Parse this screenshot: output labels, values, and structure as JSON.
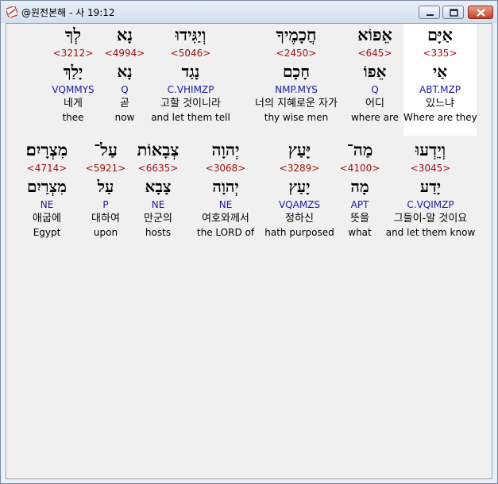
{
  "window": {
    "title": "@원전본해 - 사 19:12",
    "buttons": {
      "minimize": "minimize",
      "maximize": "maximize",
      "close": "close"
    }
  },
  "rows": [
    {
      "words": [
        {
          "hebrew": "אַיָּם",
          "strong": "<335>",
          "lemma": "אַי",
          "morph": "ABT.MZP",
          "korean": "있느냐",
          "english": "Where are they",
          "highlighted": true
        },
        {
          "hebrew": "אֵפוֹא",
          "strong": "<645>",
          "lemma": "אֵפוֹ",
          "morph": "Q",
          "korean": "어디",
          "english": "where are",
          "highlighted": false
        },
        {
          "hebrew": "חֲכָמֶיךָ",
          "strong": "<2450>",
          "lemma": "חָכָם",
          "morph": "NMP.MYS",
          "korean": "너의 지혜로운 자가",
          "english": "thy wise men",
          "highlighted": false
        },
        {
          "hebrew": "וְיַגִּידוּ",
          "strong": "<5046>",
          "lemma": "נָגַד",
          "morph": "C.VHIMZP",
          "korean": "고할 것이니라",
          "english": "and let them tell",
          "highlighted": false
        },
        {
          "hebrew": "נָא",
          "strong": "<4994>",
          "lemma": "נָא",
          "morph": "Q",
          "korean": "곧",
          "english": "now",
          "highlighted": false
        },
        {
          "hebrew": "לְךָ",
          "strong": "<3212>",
          "lemma": "יָלַךְ",
          "morph": "VQMMYS",
          "korean": "네게",
          "english": "thee",
          "highlighted": false
        }
      ]
    },
    {
      "words": [
        {
          "hebrew": "וְיֵדְעוּ",
          "strong": "<3045>",
          "lemma": "יָדַע",
          "morph": "C.VQIMZP",
          "korean": "그들이-알 것이요",
          "english": "and let them know",
          "highlighted": false
        },
        {
          "hebrew": "מַה־",
          "strong": "<4100>",
          "lemma": "מָה",
          "morph": "APT",
          "korean": "뜻을",
          "english": "what",
          "highlighted": false
        },
        {
          "hebrew": "יָּעַץ",
          "strong": "<3289>",
          "lemma": "יָעַץ",
          "morph": "VQAMZS",
          "korean": "정하신",
          "english": "hath purposed",
          "highlighted": false
        },
        {
          "hebrew": "יְהוָה",
          "strong": "<3068>",
          "lemma": "יְהוָה",
          "morph": "NE",
          "korean": "여호와께서",
          "english": "the LORD of",
          "highlighted": false
        },
        {
          "hebrew": "צְבָאוֹת",
          "strong": "<6635>",
          "lemma": "צָבָא",
          "morph": "NE",
          "korean": "만군의",
          "english": "hosts",
          "highlighted": false
        },
        {
          "hebrew": "עַל־",
          "strong": "<5921>",
          "lemma": "עַל",
          "morph": "P",
          "korean": "대하여",
          "english": "upon",
          "highlighted": false
        },
        {
          "hebrew": "מִצְרָיִם׃",
          "strong": "<4714>",
          "lemma": "מִצְרַיִם",
          "morph": "NE",
          "korean": "애굽에",
          "english": "Egypt",
          "highlighted": false
        }
      ]
    }
  ],
  "colors": {
    "strong": "#a01010",
    "morph": "#1a1aa0",
    "highlight": "#ffffff"
  }
}
